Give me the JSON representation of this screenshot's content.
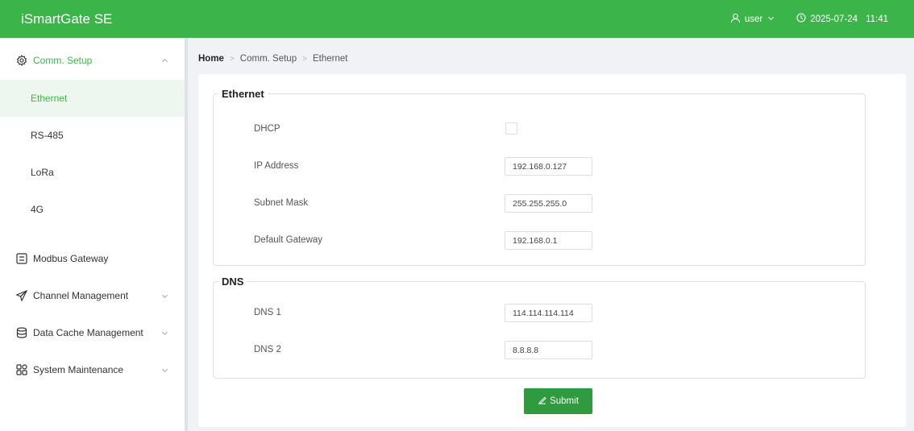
{
  "header": {
    "app_title": "iSmartGate SE",
    "user_label": "user",
    "date": "2025-07-24",
    "time": "11:41",
    "accent_color": "#3bb54a"
  },
  "sidebar": {
    "comm_setup": {
      "label": "Comm. Setup",
      "icon": "gear-icon",
      "expanded": true
    },
    "comm_items": [
      {
        "label": "Ethernet",
        "active": true
      },
      {
        "label": "RS-485"
      },
      {
        "label": "LoRa"
      },
      {
        "label": "4G"
      }
    ],
    "modbus": {
      "label": "Modbus Gateway",
      "icon": "gateway-icon"
    },
    "channel": {
      "label": "Channel Management",
      "icon": "paper-plane-icon"
    },
    "cache": {
      "label": "Data Cache Management",
      "icon": "database-icon"
    },
    "maintenance": {
      "label": "System Maintenance",
      "icon": "grid-icon"
    }
  },
  "breadcrumb": {
    "home": "Home",
    "level1": "Comm. Setup",
    "level2": "Ethernet"
  },
  "ethernet": {
    "legend": "Ethernet",
    "dhcp_label": "DHCP",
    "dhcp_checked": false,
    "ip_label": "IP Address",
    "ip_value": "192.168.0.127",
    "mask_label": "Subnet Mask",
    "mask_value": "255.255.255.0",
    "gateway_label": "Default Gateway",
    "gateway_value": "192.168.0.1"
  },
  "dns": {
    "legend": "DNS",
    "dns1_label": "DNS 1",
    "dns1_value": "114.114.114.114",
    "dns2_label": "DNS 2",
    "dns2_value": "8.8.8.8"
  },
  "submit_label": "Submit"
}
